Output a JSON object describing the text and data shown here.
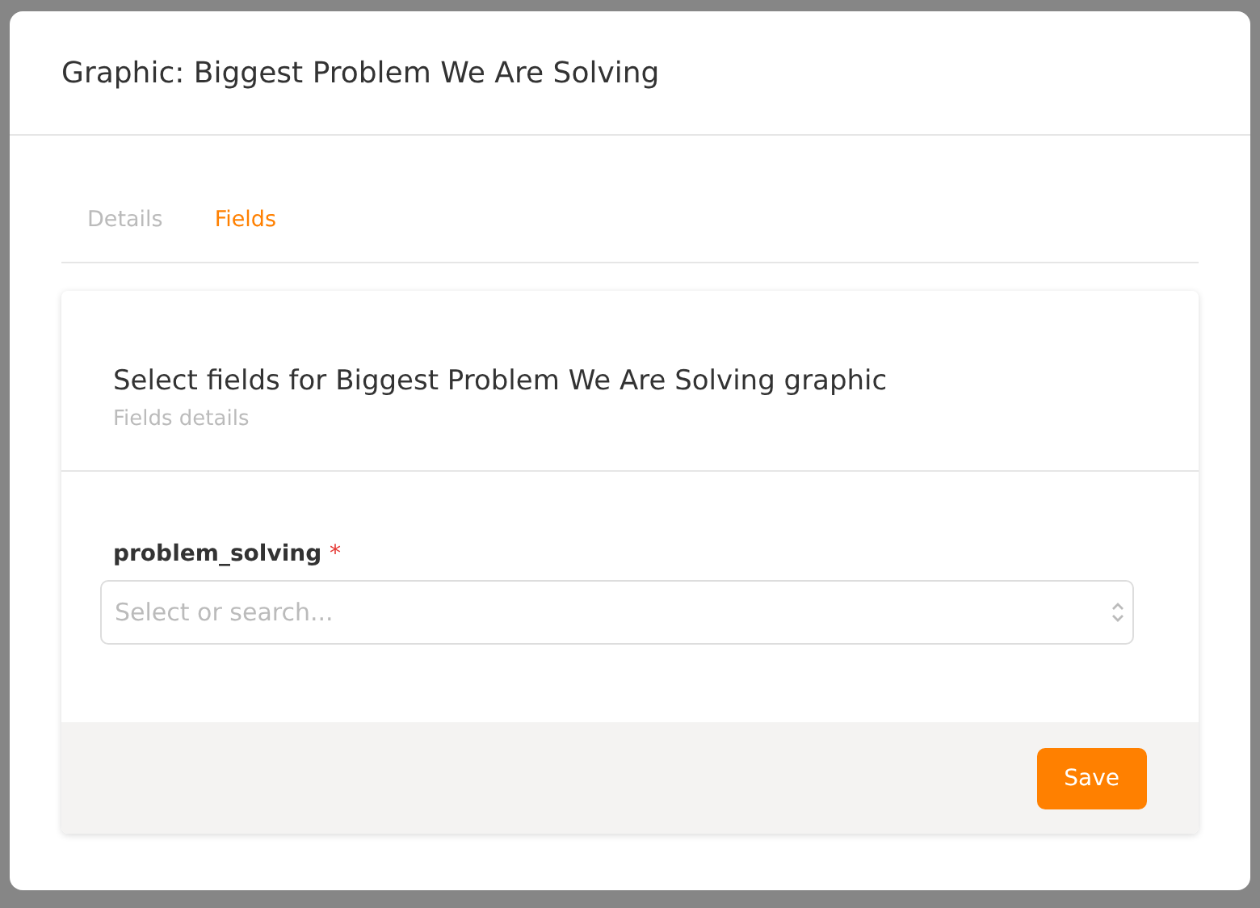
{
  "dialog": {
    "title": "Graphic: Biggest Problem We Are Solving"
  },
  "tabs": [
    {
      "label": "Details",
      "selected": false
    },
    {
      "label": "Fields",
      "selected": true
    }
  ],
  "card": {
    "title": "Select fields for Biggest Problem We Are Solving graphic",
    "subtitle": "Fields details",
    "field": {
      "label": "problem_solving",
      "required_mark": "*",
      "placeholder": "Select or search..."
    },
    "buttons": [
      {
        "label": "Save"
      }
    ]
  }
}
